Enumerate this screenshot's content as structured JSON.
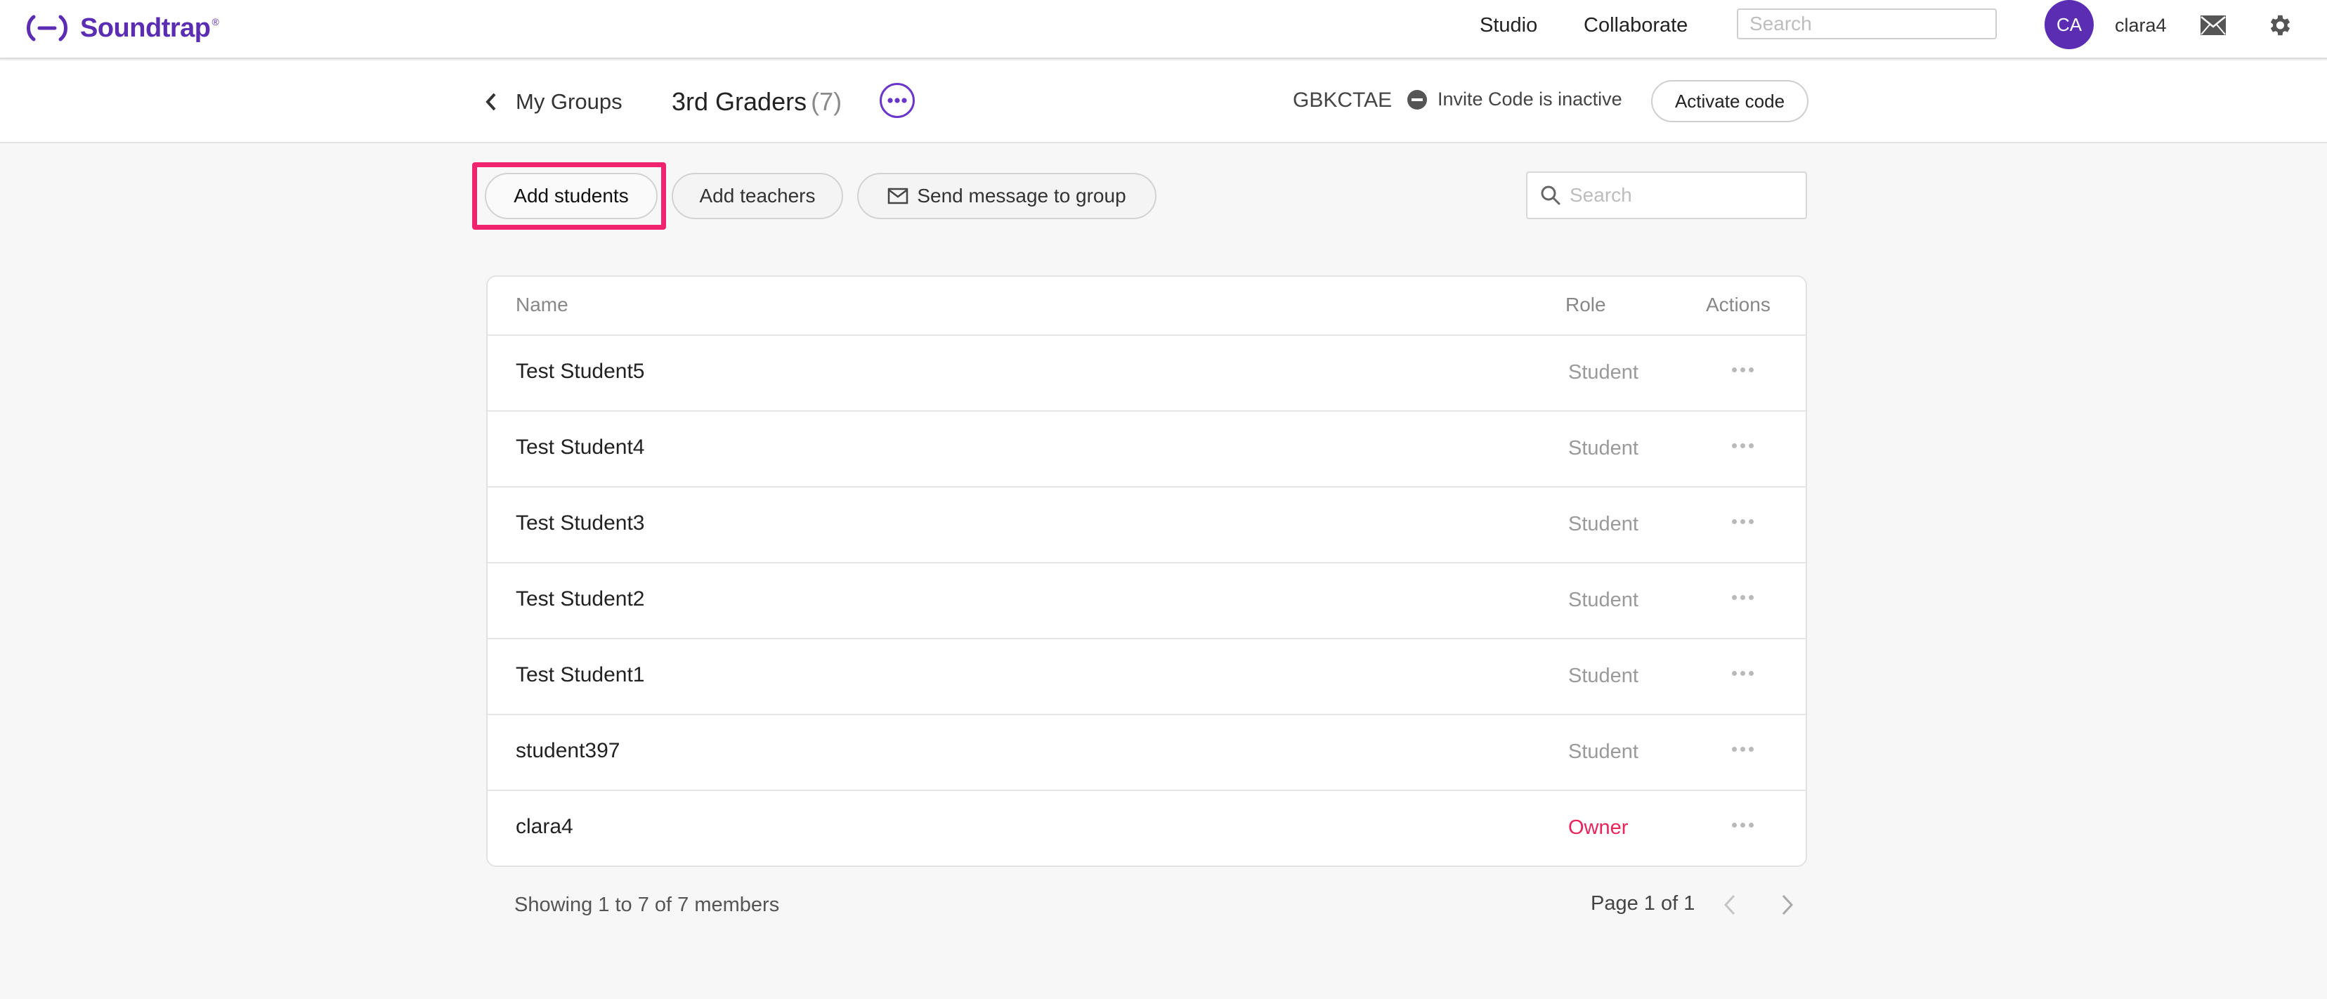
{
  "app": {
    "brand": "Soundtrap",
    "registered_mark": "®",
    "brand_color": "#5a2db3"
  },
  "topnav": {
    "links": [
      {
        "label": "Studio"
      },
      {
        "label": "Collaborate"
      }
    ],
    "search_placeholder": "Search",
    "avatar_initials": "CA",
    "username": "clara4",
    "icons": [
      "mail-icon",
      "gear-icon"
    ]
  },
  "group": {
    "back_label": "My Groups",
    "title": "3rd Graders",
    "count": "(7)",
    "invite_code": "GBKCTAE",
    "invite_status": "Invite Code is inactive",
    "activate_label": "Activate code"
  },
  "toolbar": {
    "add_students": "Add students",
    "add_teachers": "Add teachers",
    "send_message": "Send message to group",
    "search_placeholder": "Search",
    "highlight_color": "#f0246e"
  },
  "table": {
    "headers": {
      "name": "Name",
      "role": "Role",
      "actions": "Actions"
    },
    "rows": [
      {
        "name": "Test Student5",
        "role": "Student"
      },
      {
        "name": "Test Student4",
        "role": "Student"
      },
      {
        "name": "Test Student3",
        "role": "Student"
      },
      {
        "name": "Test Student2",
        "role": "Student"
      },
      {
        "name": "Test Student1",
        "role": "Student"
      },
      {
        "name": "student397",
        "role": "Student"
      },
      {
        "name": "clara4",
        "role": "Owner"
      }
    ],
    "owner_color": "#e8245a"
  },
  "footer": {
    "showing": "Showing 1 to 7 of 7 members",
    "page": "Page 1 of 1"
  }
}
